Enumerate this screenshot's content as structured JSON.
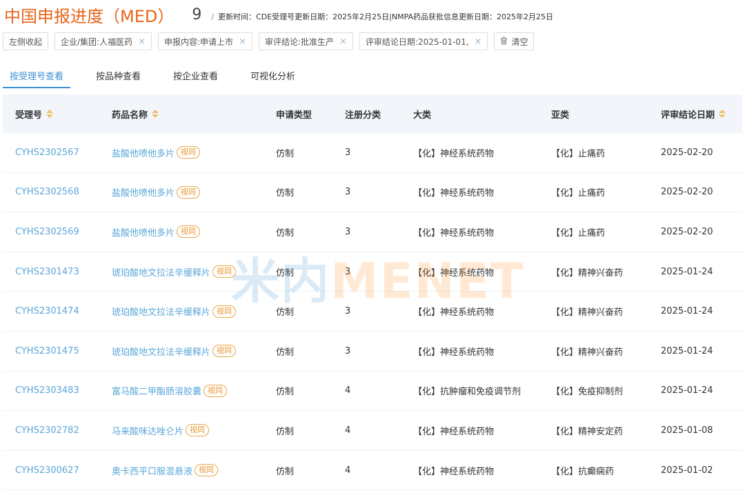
{
  "header": {
    "title": "中国申报进度（MED）",
    "count": "9",
    "separator": "/",
    "update_text": "更新时间：CDE受理号更新日期：2025年2月25日|NMPA药品获批信息更新日期：2025年2月25日"
  },
  "filters": {
    "collapse_label": "左侧收起",
    "tags": [
      {
        "label": "企业/集团:人福医药"
      },
      {
        "label": "申报内容:申请上市"
      },
      {
        "label": "审评结论:批准生产"
      },
      {
        "label": "评审结论日期:2025-01-01,"
      }
    ],
    "clear_label": "清空",
    "close_glyph": "×"
  },
  "tabs": [
    {
      "label": "按受理号查看",
      "active": true
    },
    {
      "label": "按品种查看"
    },
    {
      "label": "按企业查看"
    },
    {
      "label": "可视化分析"
    }
  ],
  "table": {
    "columns": [
      "受理号",
      "药品名称",
      "申请类型",
      "注册分类",
      "大类",
      "亚类",
      "评审结论日期"
    ],
    "badge_label": "视同",
    "rows": [
      {
        "code": "CYHS2302567",
        "drug": "盐酸他喷他多片",
        "type": "仿制",
        "reg": "3",
        "cat": "【化】神经系统药物",
        "sub": "【化】止痛药",
        "date": "2025-02-20"
      },
      {
        "code": "CYHS2302568",
        "drug": "盐酸他喷他多片",
        "type": "仿制",
        "reg": "3",
        "cat": "【化】神经系统药物",
        "sub": "【化】止痛药",
        "date": "2025-02-20"
      },
      {
        "code": "CYHS2302569",
        "drug": "盐酸他喷他多片",
        "type": "仿制",
        "reg": "3",
        "cat": "【化】神经系统药物",
        "sub": "【化】止痛药",
        "date": "2025-02-20"
      },
      {
        "code": "CYHS2301473",
        "drug": "琥珀酸地文拉法辛缓释片",
        "type": "仿制",
        "reg": "3",
        "cat": "【化】神经系统药物",
        "sub": "【化】精神兴奋药",
        "date": "2025-01-24"
      },
      {
        "code": "CYHS2301474",
        "drug": "琥珀酸地文拉法辛缓释片",
        "type": "仿制",
        "reg": "3",
        "cat": "【化】神经系统药物",
        "sub": "【化】精神兴奋药",
        "date": "2025-01-24"
      },
      {
        "code": "CYHS2301475",
        "drug": "琥珀酸地文拉法辛缓释片",
        "type": "仿制",
        "reg": "3",
        "cat": "【化】神经系统药物",
        "sub": "【化】精神兴奋药",
        "date": "2025-01-24"
      },
      {
        "code": "CYHS2303483",
        "drug": "富马酸二甲酯肠溶胶囊",
        "type": "仿制",
        "reg": "4",
        "cat": "【化】抗肿瘤和免疫调节剂",
        "sub": "【化】免疫抑制剂",
        "date": "2025-01-24"
      },
      {
        "code": "CYHS2302782",
        "drug": "马来酸咪达唑仑片",
        "type": "仿制",
        "reg": "4",
        "cat": "【化】神经系统药物",
        "sub": "【化】精神安定药",
        "date": "2025-01-08"
      },
      {
        "code": "CYHS2300627",
        "drug": "奥卡西平口服混悬液",
        "type": "仿制",
        "reg": "4",
        "cat": "【化】神经系统药物",
        "sub": "【化】抗癫痫药",
        "date": "2025-01-02"
      }
    ]
  },
  "watermark": {
    "cn": "米内",
    "en": "MENET"
  },
  "colors": {
    "title": "#e8641b",
    "link": "#5aa7d9",
    "accent": "#3b8fd6",
    "badge": "#e8932a"
  }
}
